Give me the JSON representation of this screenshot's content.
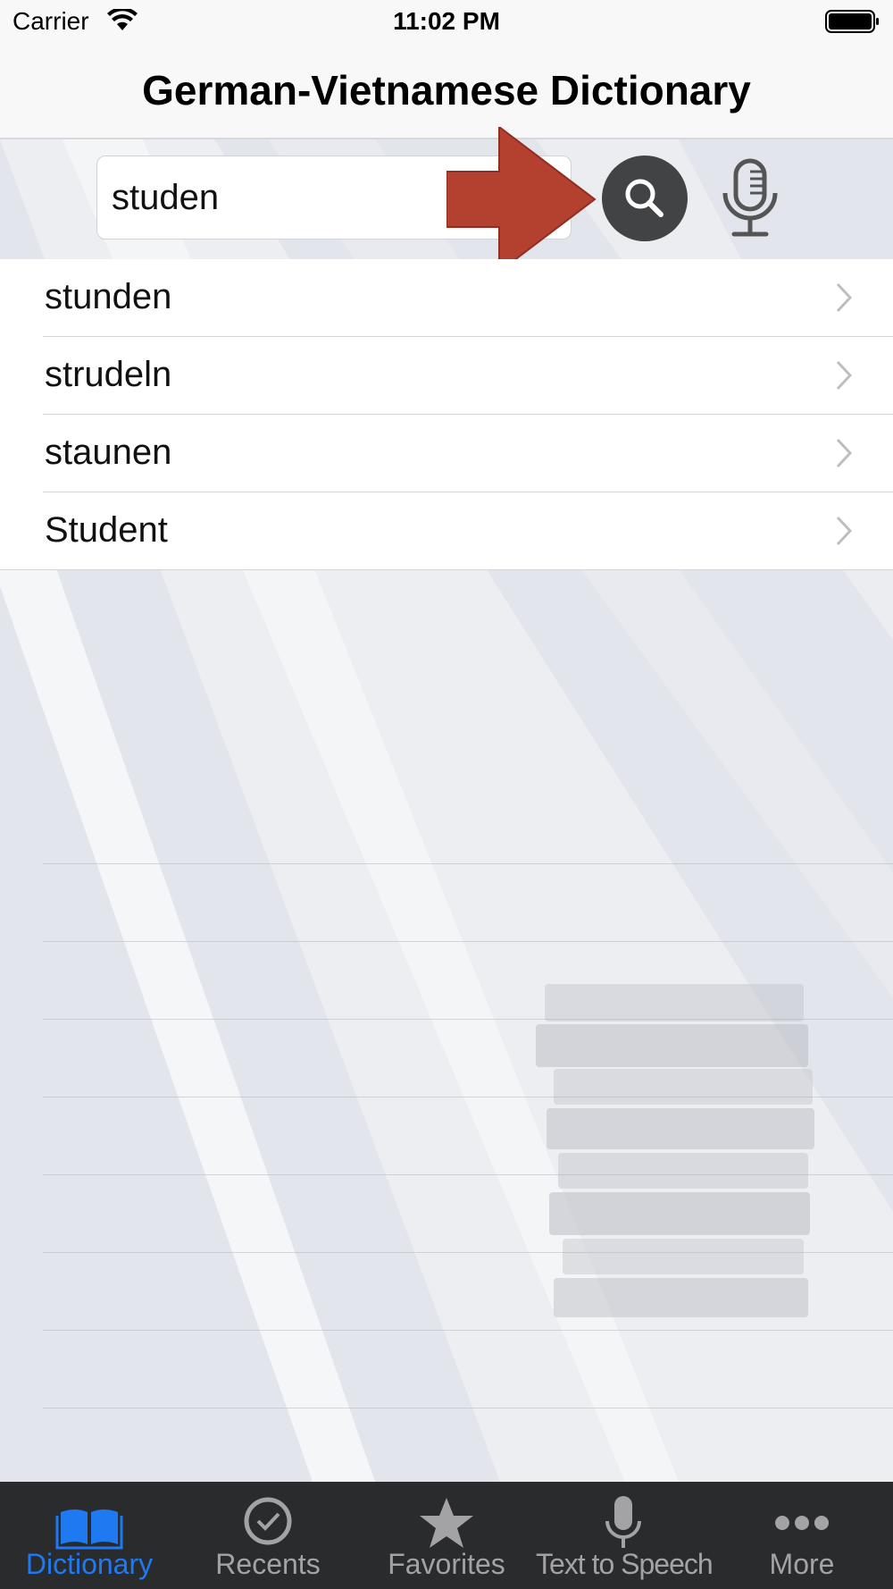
{
  "status": {
    "carrier": "Carrier",
    "time": "11:02 PM"
  },
  "nav": {
    "title": "German-Vietnamese Dictionary"
  },
  "search": {
    "value": "studen"
  },
  "results": [
    "stunden",
    "strudeln",
    "staunen",
    "Student"
  ],
  "tabs": [
    {
      "label": "Dictionary",
      "icon": "book-icon",
      "active": true
    },
    {
      "label": "Recents",
      "icon": "clock-check-icon",
      "active": false
    },
    {
      "label": "Favorites",
      "icon": "star-icon",
      "active": false
    },
    {
      "label": "Text to Speech",
      "icon": "microphone-icon",
      "active": false
    },
    {
      "label": "More",
      "icon": "ellipsis-icon",
      "active": false
    }
  ],
  "colors": {
    "active_tab": "#1f7af2",
    "arrow": "#b4402f",
    "tabbar": "#2a2b2d"
  }
}
